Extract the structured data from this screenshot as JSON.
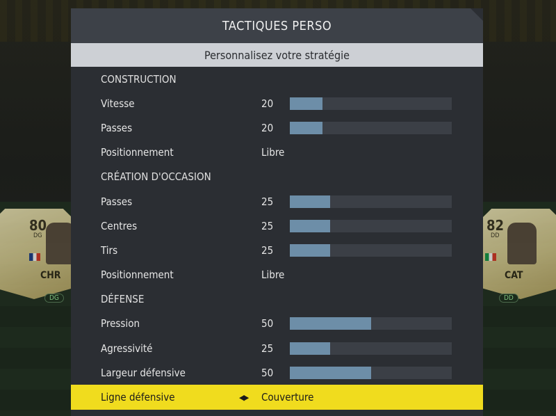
{
  "panel": {
    "title": "TACTIQUES PERSO",
    "subtitle": "Personnalisez votre stratégie"
  },
  "rows": [
    {
      "type": "section",
      "label": "CONSTRUCTION"
    },
    {
      "type": "slider",
      "label": "Vitesse",
      "value": "20",
      "level": 20
    },
    {
      "type": "slider",
      "label": "Passes",
      "value": "20",
      "level": 20
    },
    {
      "type": "text",
      "label": "Positionnement",
      "value": "Libre"
    },
    {
      "type": "section",
      "label": "CRÉATION D'OCCASION"
    },
    {
      "type": "slider",
      "label": "Passes",
      "value": "25",
      "level": 25
    },
    {
      "type": "slider",
      "label": "Centres",
      "value": "25",
      "level": 25
    },
    {
      "type": "slider",
      "label": "Tirs",
      "value": "25",
      "level": 25
    },
    {
      "type": "text",
      "label": "Positionnement",
      "value": "Libre"
    },
    {
      "type": "section",
      "label": "DÉFENSE"
    },
    {
      "type": "slider",
      "label": "Pression",
      "value": "50",
      "level": 50
    },
    {
      "type": "slider",
      "label": "Agressivité",
      "value": "25",
      "level": 25
    },
    {
      "type": "slider",
      "label": "Largeur défensive",
      "value": "50",
      "level": 50
    },
    {
      "type": "select",
      "label": "Ligne défensive",
      "value": "Couverture",
      "arrows": "◀▶"
    }
  ],
  "cards": {
    "left": {
      "rating": "80",
      "position": "DG",
      "name": "CHR",
      "badge": "DG"
    },
    "right": {
      "rating": "82",
      "position": "DD",
      "name": "CAT",
      "badge": "DD"
    }
  },
  "colors": {
    "accent": "#f0dc1e",
    "bar_fill": "#6d8ea8",
    "bar_track": "#3b3f46"
  }
}
